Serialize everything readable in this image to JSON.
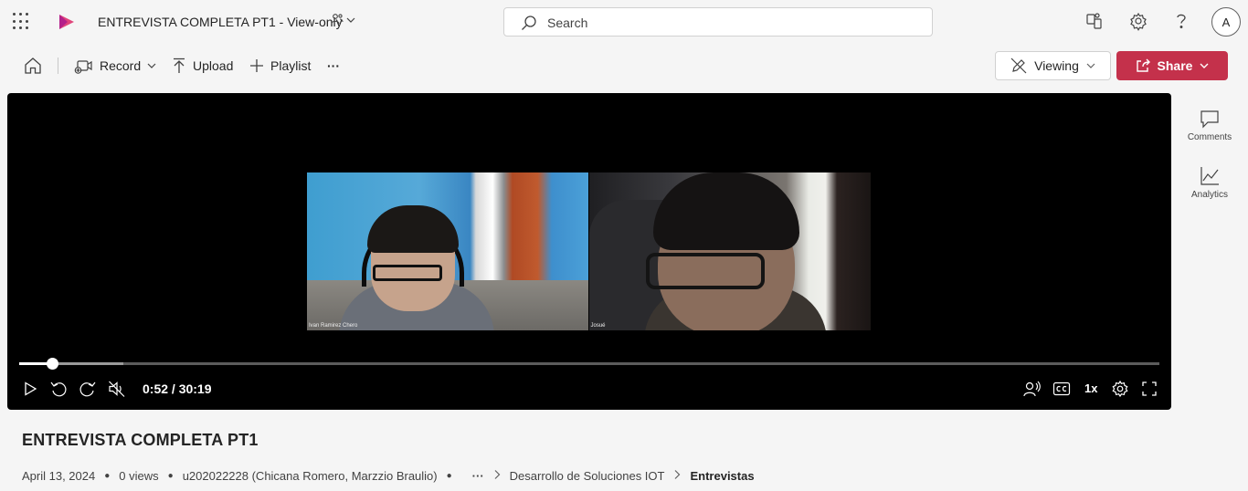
{
  "app": {
    "doc_title": "ENTREVISTA COMPLETA PT1 - View-only",
    "search_placeholder": "Search",
    "avatar_initial": "A",
    "brand_color": "#c4314b"
  },
  "toolbar": {
    "record_label": "Record",
    "upload_label": "Upload",
    "playlist_label": "Playlist",
    "more_label": "···",
    "viewing_label": "Viewing",
    "share_label": "Share"
  },
  "player": {
    "participants": [
      {
        "name": "Ivan Ramirez Chero"
      },
      {
        "name": "Josué"
      }
    ],
    "current_time": "0:52",
    "duration": "30:19",
    "time_display": "0:52 / 30:19",
    "progress_fraction": 0.029,
    "speed_label": "1x",
    "skip_back_seconds": "10",
    "skip_forward_seconds": "10"
  },
  "side_rail": {
    "comments_label": "Comments",
    "analytics_label": "Analytics"
  },
  "video": {
    "title": "ENTREVISTA COMPLETA PT1",
    "date": "April 13, 2024",
    "views": "0 views",
    "owner": "u202022228 (Chicana Romero, Marzzio Braulio)",
    "breadcrumb_more": "···",
    "breadcrumb": [
      "Desarrollo de Soluciones IOT",
      "Entrevistas"
    ]
  }
}
